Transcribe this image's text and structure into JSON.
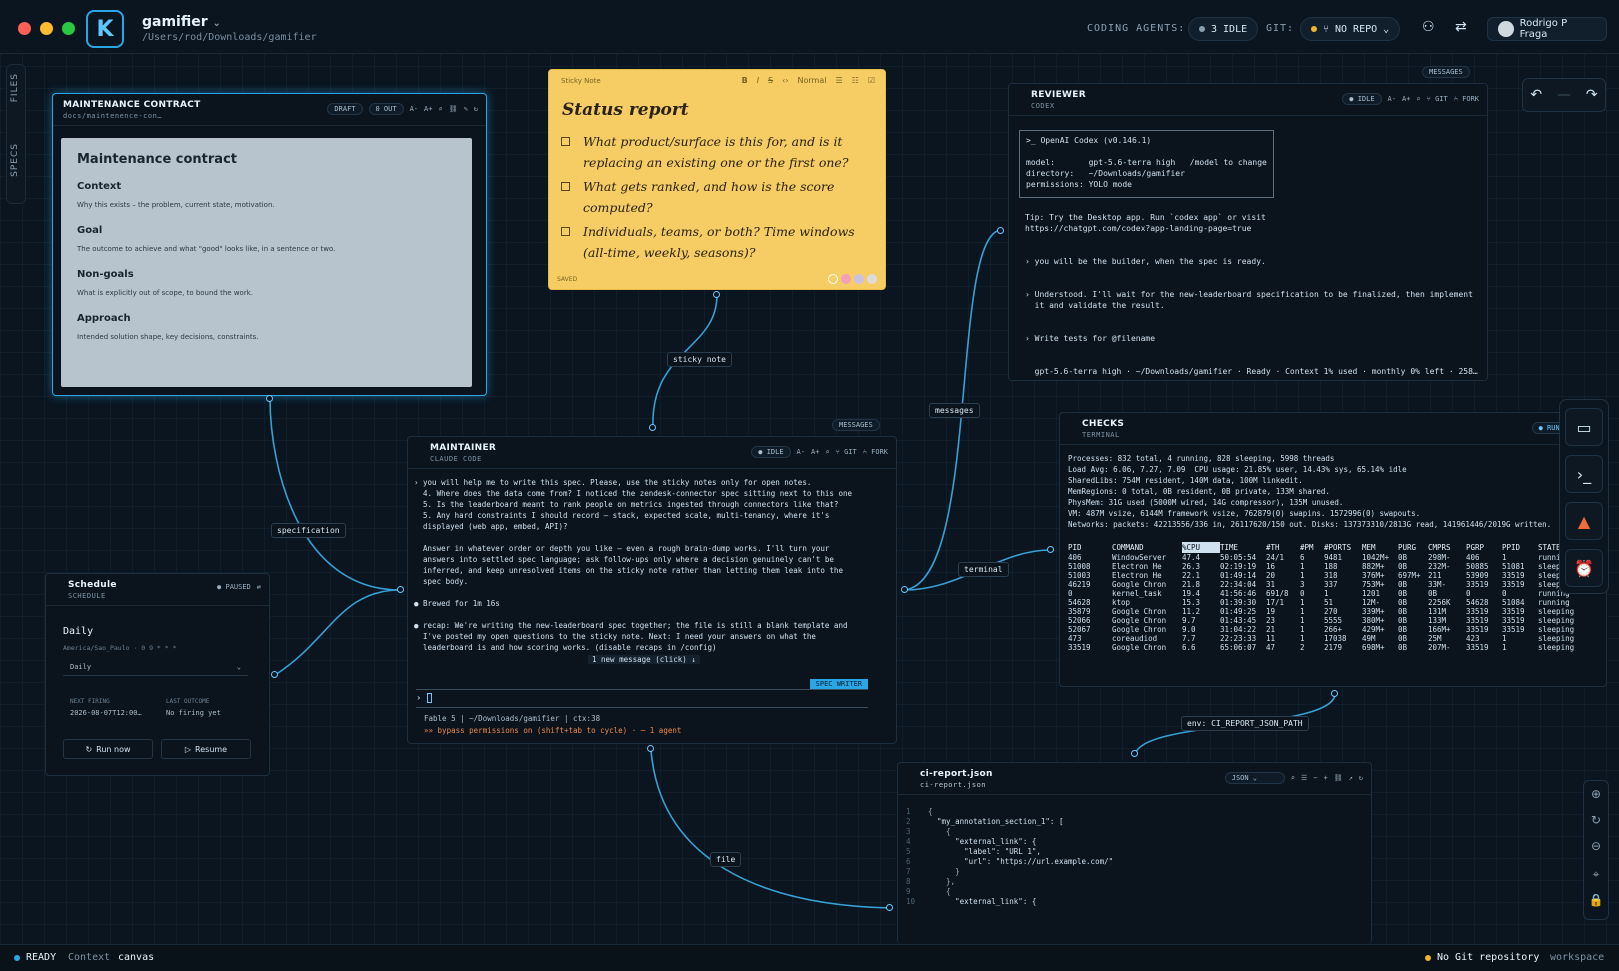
{
  "app": {
    "project_name": "gamifier",
    "project_path": "/Users/rod/Downloads/gamifier",
    "logo_letter": "K"
  },
  "topbar": {
    "coding_agents_label": "CODING AGENTS:",
    "agents_status": "3 IDLE",
    "git_label": "GIT:",
    "git_status": "NO REPO",
    "user_name": "Rodrigo P Fraga"
  },
  "rail": {
    "files": "FILES",
    "specs": "SPECS"
  },
  "maintenance": {
    "title": "MAINTENANCE CONTRACT",
    "path": "docs/maintenence-con…",
    "draft": "DRAFT",
    "out": "0 OUT",
    "doc_title": "Maintenance contract",
    "sections": [
      {
        "h": "Context",
        "t": "Why this exists – the problem, current state, motivation."
      },
      {
        "h": "Goal",
        "t": "The outcome to achieve and what \"good\" looks like, in a sentence or two."
      },
      {
        "h": "Non-goals",
        "t": "What is explicitly out of scope, to bound the work."
      },
      {
        "h": "Approach",
        "t": "Intended solution shape, key decisions, constraints."
      }
    ]
  },
  "sticky": {
    "label": "Sticky Note",
    "style": "Normal",
    "title": "Status report",
    "items": [
      "What product/surface is this for, and is it replacing an existing one or the first one?",
      "What gets ranked, and how is the score computed?",
      "Individuals, teams, or both? Time windows (all-time, weekly, seasons)?"
    ],
    "saved": "SAVED"
  },
  "reviewer": {
    "title": "REVIEWER",
    "subtitle": "CODEX",
    "idle": "IDLE",
    "git": "GIT",
    "fork": "FORK",
    "messages": "MESSAGES",
    "banner": [
      ">_ OpenAI Codex (v0.146.1)",
      "",
      "model:       gpt-5.6-terra high   /model to change",
      "directory:   ~/Downloads/gamifier",
      "permissions: YOLO mode"
    ],
    "body": "Tip: Try the Desktop app. Run `codex app` or visit\nhttps://chatgpt.com/codex?app-landing-page=true\n\n\n› you will be the builder, when the spec is ready.\n\n\n› Understood. I'll wait for the new-leaderboard specification to be finalized, then implement\n  it and validate the result.\n\n\n› Write tests for @filename\n\n\n  gpt-5.6-terra high · ~/Downloads/gamifier · Ready · Context 1% used · monthly 0% left · 258…"
  },
  "maintainer": {
    "title": "MAINTAINER",
    "subtitle": "CLAUDE CODE",
    "idle": "IDLE",
    "git": "GIT",
    "fork": "FORK",
    "messages": "MESSAGES",
    "body": "› you will help me to write this spec. Please, use the sticky notes only for open notes.\n  4. Where does the data come from? I noticed the zendesk-connector spec sitting next to this one\n  5. Is the leaderboard meant to rank people on metrics ingested through connectors like that?\n  5. Any hard constraints I should record – stack, expected scale, multi-tenancy, where it's\n  displayed (web app, embed, API)?\n\n  Answer in whatever order or depth you like – even a rough brain-dump works. I'll turn your\n  answers into settled spec language; ask follow-ups only where a decision genuinely can't be\n  inferred, and keep unresolved items on the sticky note rather than letting them leak into the\n  spec body.\n\n● Brewed for 1m 16s\n\n● recap: We're writing the new-leaderboard spec together; the file is still a blank template and\n  I've posted my open questions to the sticky note. Next: I need your answers on what the\n  leaderboard is and how scoring works. (disable recaps in /config)",
    "new_message": "1 new message (click) ↓",
    "spec_writer": "SPEC WRITER",
    "prompt": "›",
    "footer1": "Fable 5 | ~/Downloads/gamifier | ctx:38",
    "footer2": "»» bypass permissions on (shift+tab to cycle) · ─ 1 agent"
  },
  "checks": {
    "title": "CHECKS",
    "subtitle": "TERMINAL",
    "running": "RUNNING",
    "header": "Processes: 832 total, 4 running, 828 sleeping, 5998 threads\nLoad Avg: 6.06, 7.27, 7.09  CPU usage: 21.85% user, 14.43% sys, 65.14% idle\nSharedLibs: 754M resident, 140M data, 100M linkedit.\nMemRegions: 0 total, 0B resident, 0B private, 133M shared.\nPhysMem: 31G used (5000M wired, 14G compressor), 135M unused.\nVM: 487M vsize, 6144M framework vsize, 762879(0) swapins. 1572996(0) swapouts.\nNetworks: packets: 42213556/336 in, 26117620/150 out. Disks: 137373310/2813G read, 141961446/2019G written.",
    "cols": [
      "PID",
      "COMMAND",
      "%CPU",
      "TIME",
      "#TH",
      "#PM",
      "#PORTS",
      "MEM",
      "PURG",
      "CMPRS",
      "PGRP",
      "PPID",
      "STATE"
    ],
    "rows": [
      [
        "406",
        "WindowServer",
        "47.4",
        "50:05:54",
        "24/1",
        "6",
        "9481",
        "1042M+",
        "0B",
        "298M-",
        "406",
        "1",
        "running"
      ],
      [
        "51008",
        "Electron He",
        "26.3",
        "02:19:19",
        "16",
        "1",
        "188",
        "882M+",
        "0B",
        "232M-",
        "50885",
        "51081",
        "sleeping"
      ],
      [
        "51003",
        "Electron He",
        "22.1",
        "01:49:14",
        "20",
        "1",
        "318",
        "376M+",
        "697M+",
        "211",
        "53909",
        "33519",
        "sleeping"
      ],
      [
        "46219",
        "Google Chron",
        "21.8",
        "22:34:04",
        "31",
        "3",
        "337",
        "753M+",
        "0B",
        "33M-",
        "33519",
        "33519",
        "sleeping"
      ],
      [
        "0",
        "kernel_task",
        "19.4",
        "41:56:46",
        "691/8",
        "0",
        "1",
        "1201",
        "0B",
        "0B",
        "0",
        "0",
        "running"
      ],
      [
        "54628",
        "ktop",
        "15.3",
        "01:39:30",
        "17/1",
        "1",
        "51",
        "12M-",
        "0B",
        "2256K",
        "54628",
        "51084",
        "running"
      ],
      [
        "35879",
        "Google Chron",
        "11.2",
        "01:49:25",
        "19",
        "1",
        "270",
        "339M+",
        "0B",
        "131M",
        "33519",
        "33519",
        "sleeping"
      ],
      [
        "52066",
        "Google Chron",
        "9.7",
        "01:43:45",
        "23",
        "1",
        "5555",
        "380M+",
        "0B",
        "133M",
        "33519",
        "33519",
        "sleeping"
      ],
      [
        "52067",
        "Google Chron",
        "9.0",
        "31:04:22",
        "21",
        "1",
        "266+",
        "429M+",
        "0B",
        "166M+",
        "33519",
        "33519",
        "sleeping"
      ],
      [
        "473",
        "coreaudiod",
        "7.7",
        "22:23:33",
        "11",
        "1",
        "17038",
        "49M",
        "0B",
        "25M",
        "423",
        "1",
        "sleeping"
      ],
      [
        "33519",
        "Google Chron",
        "6.6",
        "65:06:07",
        "47",
        "2",
        "2179",
        "698M+",
        "0B",
        "207M-",
        "33519",
        "1",
        "sleeping"
      ]
    ]
  },
  "schedule": {
    "title": "Schedule",
    "subtitle": "SCHEDULE",
    "paused": "PAUSED",
    "name": "Daily",
    "cron": "America/Sao_Paulo · 0 9 * * *",
    "select": "Daily",
    "next_label": "NEXT FIRING",
    "next_value": "2026-08-07T12:00…",
    "last_label": "LAST OUTCOME",
    "last_value": "No firing yet",
    "run_now": "Run now",
    "resume": "Resume"
  },
  "ci_report": {
    "title": "ci-report.json",
    "subtitle": "ci-report.json",
    "format": "JSON",
    "lines": [
      "{",
      "  \"my_annotation_section_1\": [",
      "    {",
      "      \"external_link\": {",
      "        \"label\": \"URL 1\",",
      "        \"url\": \"https://url.example.com/\"",
      "      }",
      "    },",
      "    {",
      "      \"external_link\": {"
    ]
  },
  "edges": {
    "sticky_note": "sticky note",
    "specification": "specification",
    "messages": "messages",
    "terminal": "terminal",
    "file": "file",
    "env": "env: CI_REPORT_JSON_PATH"
  },
  "status": {
    "ready": "READY",
    "context_label": "Context",
    "context_value": "canvas",
    "git": "No Git repository",
    "workspace": "workspace"
  },
  "colors": {
    "accent": "#2aa6e6",
    "sticky": "#f5cd64",
    "idle": "#8aa0b2",
    "running": "#2aa6e6"
  }
}
